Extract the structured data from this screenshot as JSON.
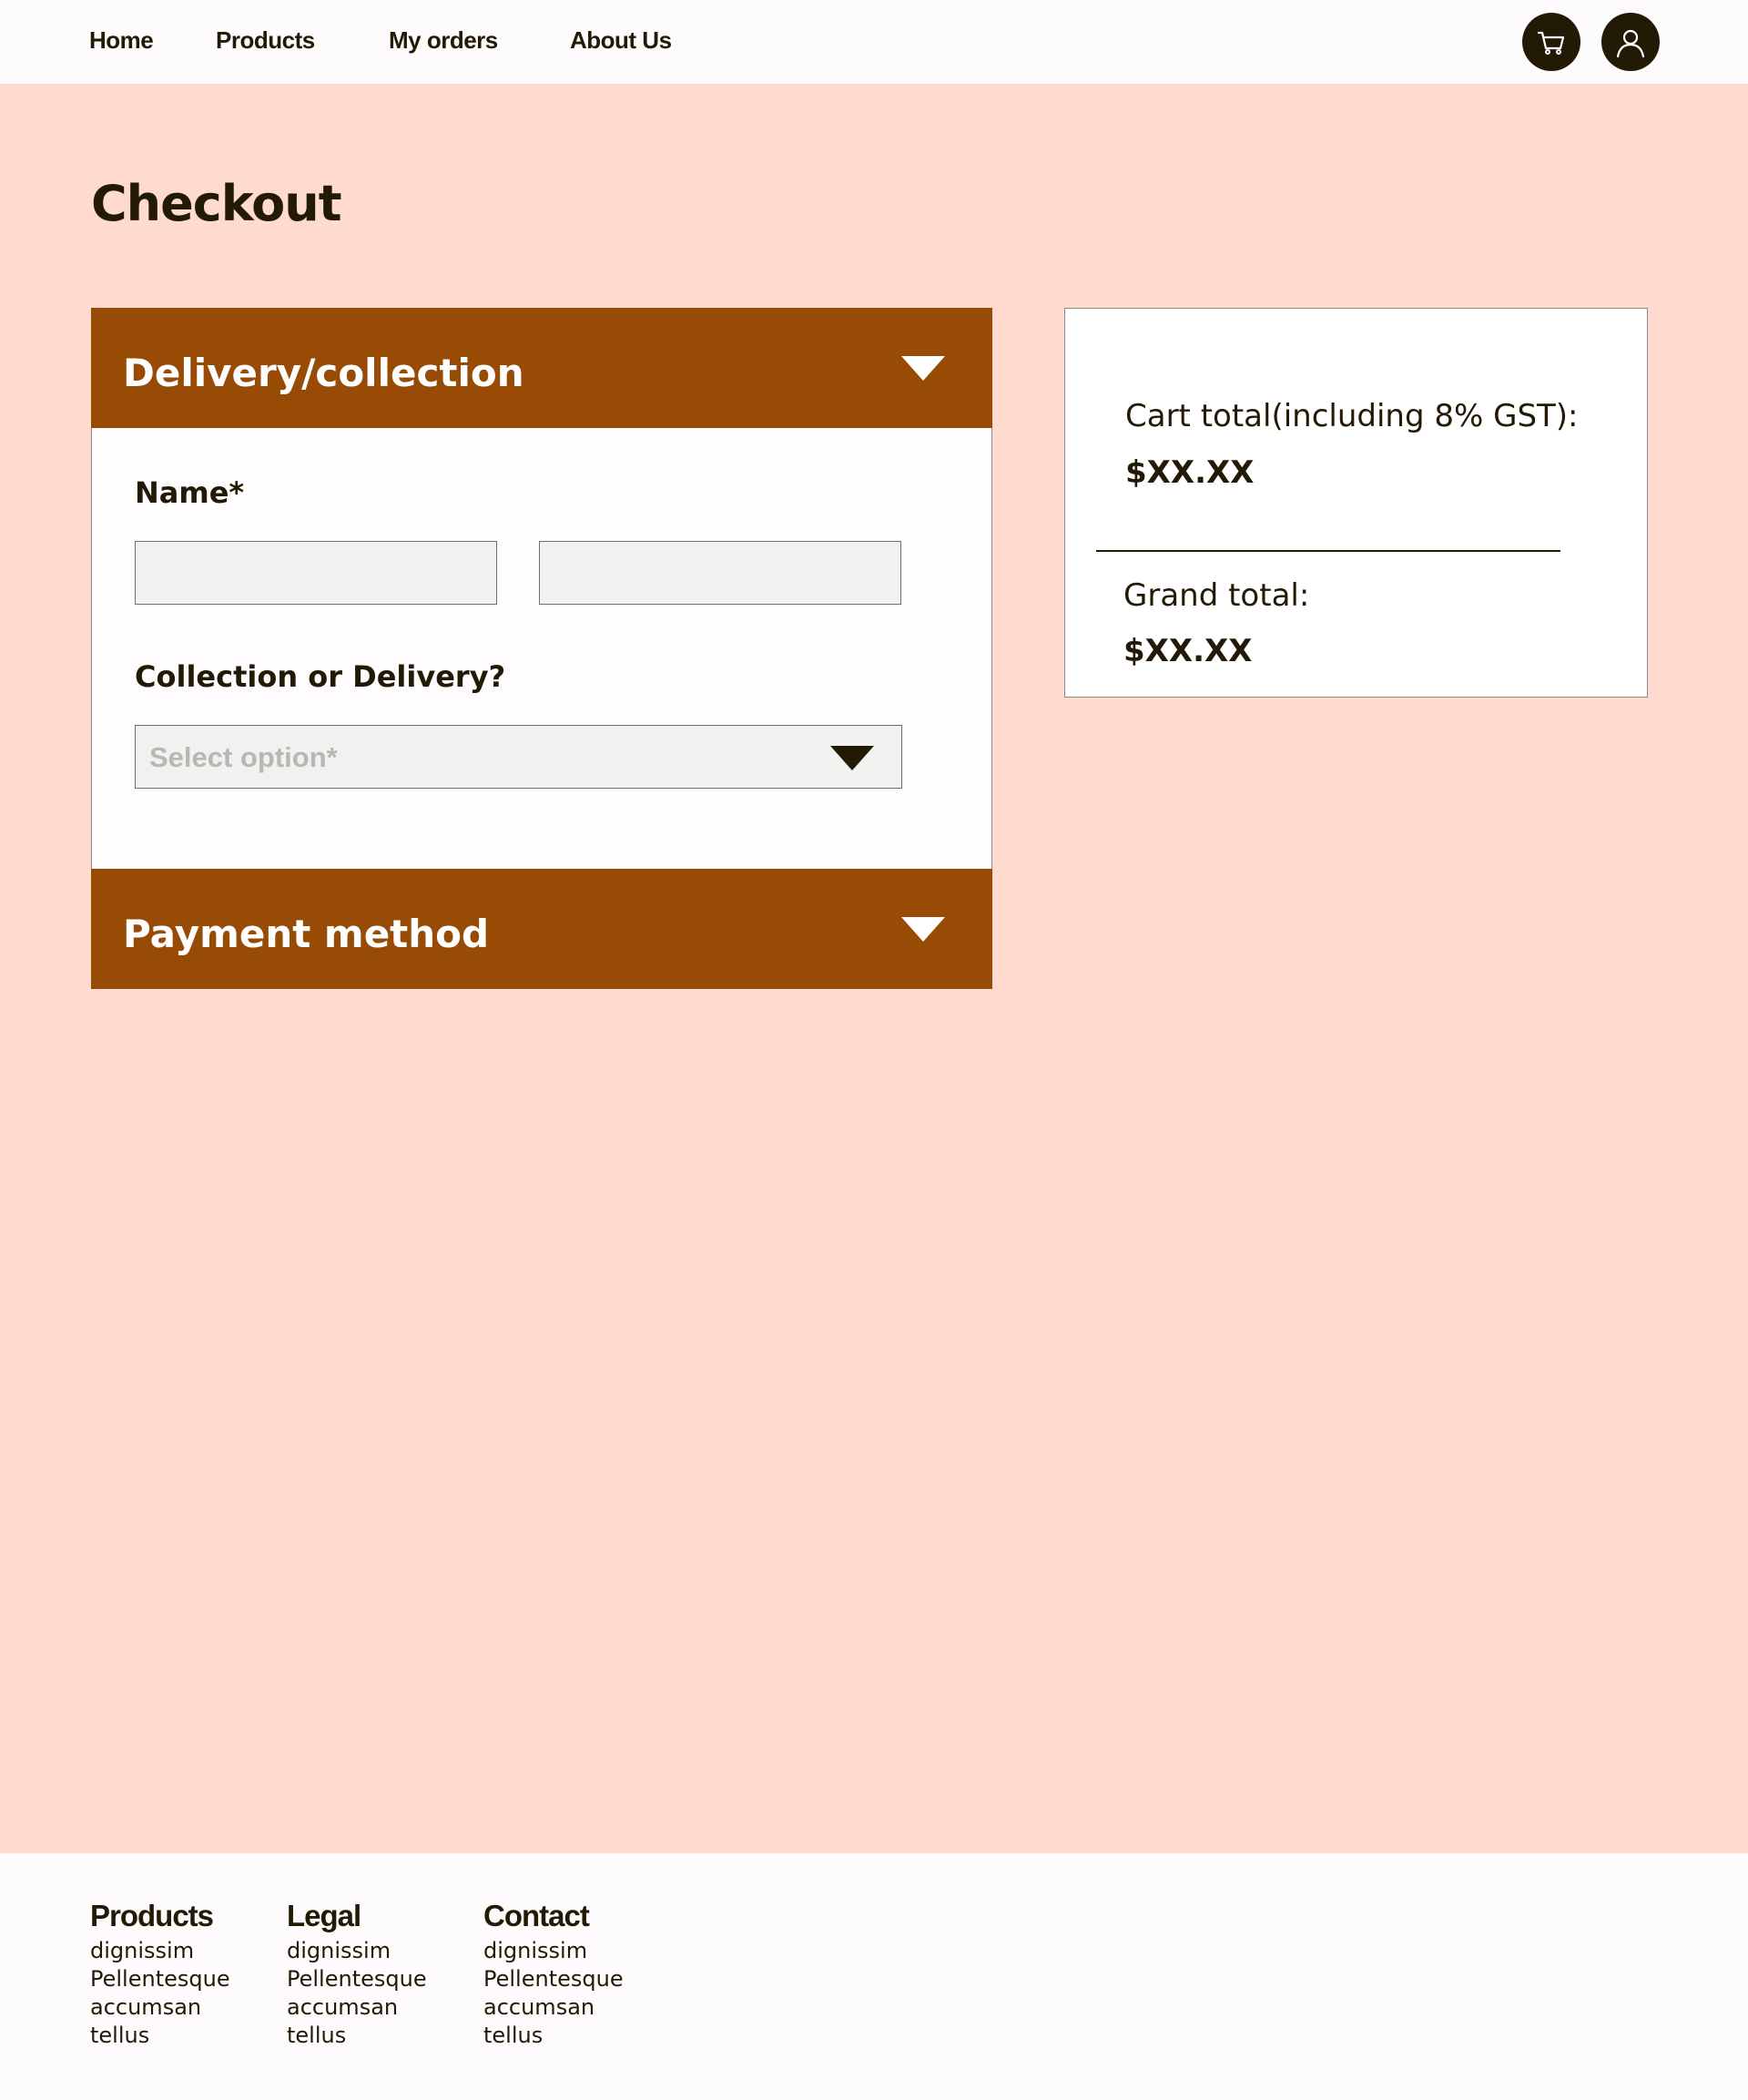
{
  "nav": {
    "links": [
      "Home",
      "Products",
      "My orders",
      "About Us"
    ],
    "cart_icon": "shopping-cart-icon",
    "account_icon": "user-icon"
  },
  "page_title": "Checkout",
  "accordion": {
    "delivery": {
      "title": "Delivery/collection",
      "name_label": "Name*",
      "first_name_value": "",
      "last_name_value": "",
      "method_label": "Collection or Delivery?",
      "method_placeholder": "Select option*"
    },
    "payment": {
      "title": "Payment method"
    }
  },
  "summary": {
    "cart_total_label": "Cart total(including 8% GST):",
    "cart_total_value": "$XX.XX",
    "grand_total_label": "Grand total:",
    "grand_total_value": "$XX.XX"
  },
  "footer": {
    "columns": [
      {
        "title": "Products",
        "items": [
          "dignissim",
          "Pellentesque",
          "accumsan",
          "tellus"
        ]
      },
      {
        "title": "Legal",
        "items": [
          "dignissim",
          "Pellentesque",
          "accumsan",
          "tellus"
        ]
      },
      {
        "title": "Contact",
        "items": [
          "dignissim",
          "Pellentesque",
          "accumsan",
          "tellus"
        ]
      }
    ]
  },
  "colors": {
    "page_bg": "#ffdacf",
    "accent": "#974b05",
    "text": "#231a06",
    "input_bg": "#f1f2f0"
  }
}
